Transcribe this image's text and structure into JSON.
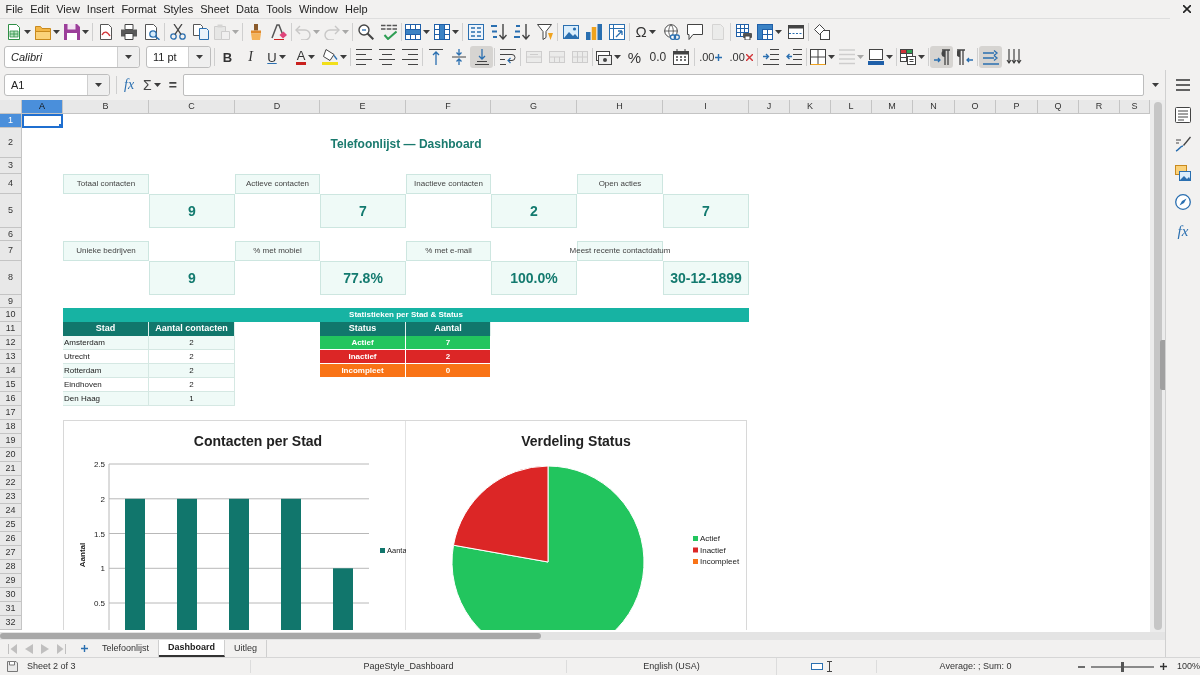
{
  "menu_bar": {
    "items": [
      "File",
      "Edit",
      "View",
      "Insert",
      "Format",
      "Styles",
      "Sheet",
      "Data",
      "Tools",
      "Window",
      "Help"
    ]
  },
  "toolbars": [
    {
      "items": [
        {
          "kind": "new",
          "dropdown": true,
          "disabled": false,
          "pressed": false
        },
        {
          "kind": "open",
          "dropdown": true,
          "disabled": false,
          "pressed": false
        },
        {
          "kind": "save",
          "dropdown": true,
          "disabled": false,
          "pressed": false
        },
        {
          "kind": "separator"
        },
        {
          "kind": "pdf",
          "dropdown": false,
          "disabled": false,
          "pressed": false
        },
        {
          "kind": "print",
          "dropdown": false,
          "disabled": false,
          "pressed": false
        },
        {
          "kind": "preview",
          "dropdown": false,
          "disabled": false,
          "pressed": false
        },
        {
          "kind": "separator"
        },
        {
          "kind": "cut",
          "dropdown": false,
          "disabled": false,
          "pressed": false
        },
        {
          "kind": "copy",
          "dropdown": false,
          "disabled": false,
          "pressed": false
        },
        {
          "kind": "paste",
          "dropdown": true,
          "disabled": true,
          "pressed": false
        },
        {
          "kind": "separator"
        },
        {
          "kind": "clone",
          "dropdown": false,
          "disabled": false,
          "pressed": false
        },
        {
          "kind": "clear",
          "dropdown": false,
          "disabled": false,
          "pressed": false
        },
        {
          "kind": "separator"
        },
        {
          "kind": "undo",
          "dropdown": true,
          "disabled": true,
          "pressed": false
        },
        {
          "kind": "redo",
          "dropdown": true,
          "disabled": true,
          "pressed": false
        },
        {
          "kind": "separator"
        },
        {
          "kind": "find",
          "dropdown": false,
          "disabled": false,
          "pressed": false
        },
        {
          "kind": "spelling",
          "dropdown": false,
          "disabled": false,
          "pressed": false
        },
        {
          "kind": "separator"
        },
        {
          "kind": "rows",
          "dropdown": true,
          "disabled": false,
          "pressed": false
        },
        {
          "kind": "columns",
          "dropdown": true,
          "disabled": false,
          "pressed": false
        },
        {
          "kind": "separator"
        },
        {
          "kind": "sort",
          "dropdown": false,
          "disabled": false,
          "pressed": false
        },
        {
          "kind": "sort_ascending",
          "dropdown": false,
          "disabled": false,
          "pressed": false
        },
        {
          "kind": "sort_descending",
          "dropdown": false,
          "disabled": false,
          "pressed": false
        },
        {
          "kind": "autofilter",
          "dropdown": false,
          "disabled": false,
          "pressed": false
        },
        {
          "kind": "separator"
        },
        {
          "kind": "image",
          "dropdown": false,
          "disabled": false,
          "pressed": false
        },
        {
          "kind": "chart",
          "dropdown": false,
          "disabled": false,
          "pressed": false
        },
        {
          "kind": "pivot",
          "dropdown": false,
          "disabled": false,
          "pressed": false
        },
        {
          "kind": "separator"
        },
        {
          "kind": "special_character",
          "label": "Ω",
          "dropdown": true,
          "disabled": false,
          "pressed": false
        },
        {
          "kind": "hyperlink",
          "dropdown": false,
          "disabled": false,
          "pressed": false
        },
        {
          "kind": "comment",
          "dropdown": false,
          "disabled": false,
          "pressed": false
        },
        {
          "kind": "header_footer",
          "dropdown": false,
          "disabled": true,
          "pressed": false
        },
        {
          "kind": "separator"
        },
        {
          "kind": "print_area",
          "dropdown": false,
          "disabled": false,
          "pressed": false
        },
        {
          "kind": "freeze",
          "dropdown": true,
          "disabled": false,
          "pressed": false
        },
        {
          "kind": "split",
          "dropdown": false,
          "disabled": false,
          "pressed": false
        },
        {
          "kind": "separator"
        },
        {
          "kind": "draw",
          "dropdown": false,
          "disabled": false,
          "pressed": false
        }
      ]
    },
    {
      "items": [
        {
          "kind": "font_name",
          "value": "Calibri"
        },
        {
          "kind": "font_size",
          "value": "11 pt"
        },
        {
          "kind": "separator"
        },
        {
          "kind": "bold",
          "label": "B",
          "dropdown": false,
          "disabled": false,
          "pressed": false
        },
        {
          "kind": "italic",
          "label": "I",
          "dropdown": false,
          "disabled": false,
          "pressed": false
        },
        {
          "kind": "underline",
          "label": "U",
          "dropdown": true,
          "disabled": false,
          "pressed": false
        },
        {
          "kind": "font_color",
          "label": "A",
          "dropdown": true,
          "disabled": false,
          "pressed": false
        },
        {
          "kind": "highlight",
          "dropdown": true,
          "disabled": false,
          "pressed": false
        },
        {
          "kind": "separator"
        },
        {
          "kind": "align_left",
          "dropdown": false,
          "disabled": false,
          "pressed": false
        },
        {
          "kind": "align_center",
          "dropdown": false,
          "disabled": false,
          "pressed": false
        },
        {
          "kind": "align_right",
          "dropdown": false,
          "disabled": false,
          "pressed": false
        },
        {
          "kind": "separator"
        },
        {
          "kind": "align_top",
          "dropdown": false,
          "disabled": false,
          "pressed": false
        },
        {
          "kind": "align_middle",
          "dropdown": false,
          "disabled": false,
          "pressed": false
        },
        {
          "kind": "align_bottom",
          "dropdown": false,
          "disabled": false,
          "pressed": true
        },
        {
          "kind": "separator"
        },
        {
          "kind": "wrap",
          "dropdown": false,
          "disabled": false,
          "pressed": false
        },
        {
          "kind": "separator"
        },
        {
          "kind": "merge_center",
          "dropdown": false,
          "disabled": true,
          "pressed": false
        },
        {
          "kind": "merge",
          "dropdown": false,
          "disabled": true,
          "pressed": false
        },
        {
          "kind": "unmerge",
          "dropdown": false,
          "disabled": true,
          "pressed": false
        },
        {
          "kind": "separator"
        },
        {
          "kind": "currency",
          "dropdown": true,
          "disabled": false,
          "pressed": false
        },
        {
          "kind": "percent",
          "label": "%",
          "dropdown": false,
          "disabled": false,
          "pressed": false
        },
        {
          "kind": "number",
          "label": "0.0",
          "dropdown": false,
          "disabled": false,
          "pressed": false
        },
        {
          "kind": "date",
          "dropdown": false,
          "disabled": false,
          "pressed": false
        },
        {
          "kind": "separator"
        },
        {
          "kind": "add_decimal",
          "label": ".00",
          "dropdown": false,
          "disabled": false,
          "pressed": false
        },
        {
          "kind": "delete_decimal",
          "label": ".00",
          "dropdown": false,
          "disabled": false,
          "pressed": false
        },
        {
          "kind": "separator"
        },
        {
          "kind": "indent_increase",
          "dropdown": false,
          "disabled": false,
          "pressed": false
        },
        {
          "kind": "indent_decrease",
          "dropdown": false,
          "disabled": false,
          "pressed": false
        },
        {
          "kind": "separator"
        },
        {
          "kind": "borders",
          "dropdown": true,
          "disabled": false,
          "pressed": false
        },
        {
          "kind": "border_style",
          "dropdown": true,
          "disabled": true,
          "pressed": false
        },
        {
          "kind": "border_color",
          "dropdown": true,
          "disabled": false,
          "pressed": false
        },
        {
          "kind": "separator"
        },
        {
          "kind": "conditional",
          "dropdown": true,
          "disabled": false,
          "pressed": false
        },
        {
          "kind": "separator"
        },
        {
          "kind": "ltr",
          "dropdown": false,
          "disabled": false,
          "pressed": true
        },
        {
          "kind": "rtl",
          "dropdown": false,
          "disabled": false,
          "pressed": false
        },
        {
          "kind": "separator"
        },
        {
          "kind": "text_ltr",
          "dropdown": false,
          "disabled": false,
          "pressed": true
        },
        {
          "kind": "text_ttb",
          "dropdown": false,
          "disabled": false,
          "pressed": false
        }
      ]
    }
  ],
  "formula_bar": {
    "name_box": "A1",
    "function_wizard": "fx",
    "sum": "Σ",
    "equals": "="
  },
  "sidebar": {
    "buttons": [
      {
        "kind": "menu"
      },
      {
        "kind": "properties"
      },
      {
        "kind": "styles"
      },
      {
        "kind": "gallery"
      },
      {
        "kind": "navigator"
      },
      {
        "kind": "functions",
        "label": "fx"
      }
    ]
  },
  "column_headers": [
    {
      "label": "A",
      "selected": true
    },
    {
      "label": "B",
      "selected": false
    },
    {
      "label": "C",
      "selected": false
    },
    {
      "label": "D",
      "selected": false
    },
    {
      "label": "E",
      "selected": false
    },
    {
      "label": "F",
      "selected": false
    },
    {
      "label": "G",
      "selected": false
    },
    {
      "label": "H",
      "selected": false
    },
    {
      "label": "I",
      "selected": false
    },
    {
      "label": "J",
      "selected": false
    },
    {
      "label": "K",
      "selected": false
    },
    {
      "label": "L",
      "selected": false
    },
    {
      "label": "M",
      "selected": false
    },
    {
      "label": "N",
      "selected": false
    },
    {
      "label": "O",
      "selected": false
    },
    {
      "label": "P",
      "selected": false
    },
    {
      "label": "Q",
      "selected": false
    },
    {
      "label": "R",
      "selected": false
    },
    {
      "label": "S",
      "selected": false
    }
  ],
  "row_headers": [
    {
      "label": "1",
      "selected": true
    },
    {
      "label": "2",
      "selected": false
    },
    {
      "label": "3",
      "selected": false
    },
    {
      "label": "4",
      "selected": false
    },
    {
      "label": "5",
      "selected": false
    },
    {
      "label": "6",
      "selected": false
    },
    {
      "label": "7",
      "selected": false
    },
    {
      "label": "8",
      "selected": false
    },
    {
      "label": "9",
      "selected": false
    },
    {
      "label": "10",
      "selected": false
    },
    {
      "label": "11",
      "selected": false
    },
    {
      "label": "12",
      "selected": false
    },
    {
      "label": "13",
      "selected": false
    },
    {
      "label": "14",
      "selected": false
    },
    {
      "label": "15",
      "selected": false
    },
    {
      "label": "16",
      "selected": false
    },
    {
      "label": "17",
      "selected": false
    },
    {
      "label": "18",
      "selected": false
    },
    {
      "label": "19",
      "selected": false
    },
    {
      "label": "20",
      "selected": false
    },
    {
      "label": "21",
      "selected": false
    },
    {
      "label": "22",
      "selected": false
    },
    {
      "label": "23",
      "selected": false
    },
    {
      "label": "24",
      "selected": false
    },
    {
      "label": "25",
      "selected": false
    },
    {
      "label": "26",
      "selected": false
    },
    {
      "label": "27",
      "selected": false
    },
    {
      "label": "28",
      "selected": false
    },
    {
      "label": "29",
      "selected": false
    },
    {
      "label": "30",
      "selected": false
    },
    {
      "label": "31",
      "selected": false
    },
    {
      "label": "32",
      "selected": false
    }
  ],
  "sheet": {
    "title": "Telefoonlijst — Dashboard",
    "kpi_rows": [
      [
        {
          "label": "Totaal contacten",
          "value": "9"
        },
        {
          "label": "Actieve contacten",
          "value": "7"
        },
        {
          "label": "Inactieve contacten",
          "value": "2"
        },
        {
          "label": "Open acties",
          "value": "7"
        }
      ],
      [
        {
          "label": "Unieke bedrijven",
          "value": "9"
        },
        {
          "label": "% met mobiel",
          "value": "77.8%"
        },
        {
          "label": "% met e-mail",
          "value": "100.0%"
        },
        {
          "label": "Meest recente contactdatum",
          "value": "30-12-1899"
        }
      ]
    ],
    "stats_banner": "Statistieken per Stad & Status",
    "city_table": {
      "columns": [
        "Stad",
        "Aantal contacten"
      ],
      "rows": [
        {
          "city": "Amsterdam",
          "count": "2"
        },
        {
          "city": "Utrecht",
          "count": "2"
        },
        {
          "city": "Rotterdam",
          "count": "2"
        },
        {
          "city": "Eindhoven",
          "count": "2"
        },
        {
          "city": "Den Haag",
          "count": "1"
        }
      ]
    },
    "status_table": {
      "columns": [
        "Status",
        "Aantal"
      ],
      "rows": [
        {
          "status": "Actief",
          "count": "7",
          "color": "#22c55e"
        },
        {
          "status": "Inactief",
          "count": "2",
          "color": "#dc2626"
        },
        {
          "status": "Incompleet",
          "count": "0",
          "color": "#f97316"
        }
      ]
    },
    "charts": [
      {
        "chart_data": {
          "type": "bar",
          "title": "Contacten per Stad",
          "ylabel": "Aantal",
          "series": [
            {
              "name": "Aanta",
              "color": "#11766c",
              "values": [
                2,
                2,
                2,
                2,
                1
              ]
            }
          ],
          "ylim": [
            0,
            2.5
          ],
          "yticks": [
            0.5,
            1,
            1.5,
            2,
            2.5
          ],
          "grid": true,
          "legend": "right"
        }
      },
      {
        "chart_data": {
          "type": "pie",
          "title": "Verdeling Status",
          "categories": [
            "Actief",
            "Inactief",
            "Incompleet"
          ],
          "values": [
            77.8,
            22.2,
            0
          ],
          "colors": [
            "#22c55e",
            "#dc2626",
            "#f97316"
          ],
          "legend": "right"
        }
      }
    ]
  },
  "sheet_tabs": {
    "nav_buttons": [
      {
        "kind": "first",
        "disabled": true
      },
      {
        "kind": "previous",
        "disabled": true
      },
      {
        "kind": "next",
        "disabled": true
      },
      {
        "kind": "last",
        "disabled": true
      }
    ],
    "tabs": [
      {
        "label": "Telefoonlijst",
        "selected": false
      },
      {
        "label": "Dashboard",
        "selected": true
      },
      {
        "label": "Uitleg",
        "selected": false
      }
    ]
  },
  "status_bar": {
    "sheet_position": "Sheet 2 of 3",
    "page_style": "PageStyle_Dashboard",
    "language": "English (USA)",
    "selection_summary": "Average: ; Sum: 0",
    "zoom": {
      "level": 0.5,
      "reading": "100%"
    }
  }
}
